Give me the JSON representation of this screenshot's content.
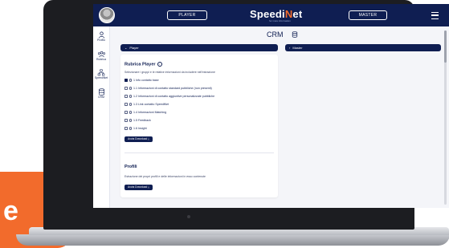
{
  "backdrop": {
    "big_letter": "e"
  },
  "topbar": {
    "left_pill": "PLAYER",
    "brand_main": "Speedi",
    "brand_accent": "N",
    "brand_tail": "et",
    "brand_sub": "for more information",
    "right_pill": "MASTER"
  },
  "sidebar": {
    "items": [
      {
        "label": "Profilo",
        "icon": "user-icon"
      },
      {
        "label": "Rubrica",
        "icon": "contacts-icon"
      },
      {
        "label": "SpeediNet",
        "icon": "network-icon"
      },
      {
        "label": "CRM",
        "icon": "database-icon"
      }
    ]
  },
  "main": {
    "title": "CRM",
    "accordion_player": "Player",
    "accordion_master": "Master",
    "rubrica": {
      "title": "Rubrica Player",
      "description": "Selezionare i gruppi e le relative informazioni da includere nell'estrazione",
      "options": [
        {
          "label": "1 Info contatto base",
          "checked": true
        },
        {
          "label": "1.1 Informazioni di contatto standard pubbliche (non presenti)",
          "checked": false
        },
        {
          "label": "1.2 Informazioni di contatto aggiuntive personalizzate pubbliche",
          "checked": false
        },
        {
          "label": "1.3 Link contatto SpeediNet",
          "checked": false
        },
        {
          "label": "1.4 Informazioni Matching",
          "checked": false
        },
        {
          "label": "1.5 Feedback",
          "checked": false
        },
        {
          "label": "1.6 Insight",
          "checked": false
        }
      ],
      "download_label": "Avvia Download"
    },
    "profilo": {
      "title": "Profili",
      "description": "Estrazione dei propri profili e delle informazioni in esso contenute",
      "download_label": "Avvia Download"
    }
  },
  "colors": {
    "navy": "#0f1e52",
    "orange": "#f26b2c",
    "page_bg": "#f4f5f9"
  }
}
